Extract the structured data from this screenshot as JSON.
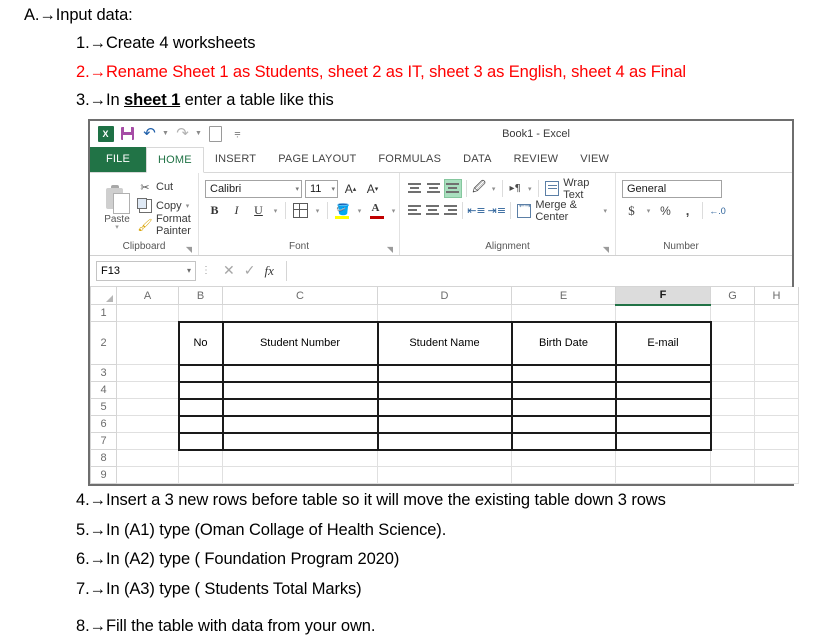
{
  "document": {
    "top_lines": [
      {
        "indent": "a",
        "prefix": "A.",
        "arrow": "→",
        "text": "Input data:",
        "color": "black",
        "bold_part": ""
      },
      {
        "indent": "n",
        "prefix": "1.",
        "arrow": "→",
        "text": "Create 4 worksheets",
        "color": "black"
      },
      {
        "indent": "n",
        "prefix": "2.",
        "arrow": "→",
        "text": "Rename Sheet 1 as Students, sheet 2 as IT, sheet 3 as English, sheet 4 as Final",
        "color": "red"
      },
      {
        "indent": "n",
        "prefix": "3.",
        "arrow": "→",
        "text_before": "In ",
        "text_bold": "sheet 1",
        "text_after": " enter a table like this",
        "color": "black"
      }
    ],
    "bottom_lines": [
      {
        "prefix": "4.",
        "arrow": "→",
        "text": "Insert a 3 new rows before table so it will move the existing table down 3 rows"
      },
      {
        "prefix": "5.",
        "arrow": "→",
        "text": "In (A1) type (Oman Collage of Health Science)."
      },
      {
        "prefix": "6.",
        "arrow": "→",
        "text": "In (A2) type ( Foundation Program 2020)"
      },
      {
        "prefix": "7.",
        "arrow": "→",
        "text": "In (A3) type ( Students Total Marks)"
      },
      {
        "prefix": "8.",
        "arrow": "→",
        "text": "Fill the table with data from your own."
      }
    ],
    "colors": {
      "red": "#ff0000",
      "black": "#000000"
    }
  },
  "excel": {
    "title": "Book1 - Excel",
    "quick_access": [
      {
        "name": "excel-logo",
        "glyph": "X"
      },
      {
        "name": "save-icon",
        "glyph": ""
      },
      {
        "name": "undo-icon",
        "glyph": "↶"
      },
      {
        "name": "redo-icon",
        "glyph": "↷"
      },
      {
        "name": "new-icon",
        "glyph": ""
      },
      {
        "name": "customize-qat-icon",
        "glyph": "≡"
      }
    ],
    "tabs": [
      {
        "label": "FILE",
        "state": "file"
      },
      {
        "label": "HOME",
        "state": "active"
      },
      {
        "label": "INSERT",
        "state": "normal"
      },
      {
        "label": "PAGE LAYOUT",
        "state": "normal"
      },
      {
        "label": "FORMULAS",
        "state": "normal"
      },
      {
        "label": "DATA",
        "state": "normal"
      },
      {
        "label": "REVIEW",
        "state": "normal"
      },
      {
        "label": "VIEW",
        "state": "normal"
      }
    ],
    "ribbon": {
      "clipboard": {
        "group_label": "Clipboard",
        "paste_label": "Paste",
        "items": [
          {
            "label": "Cut",
            "icon": "scissors-icon"
          },
          {
            "label": "Copy",
            "icon": "copy-icon"
          },
          {
            "label": "Format Painter",
            "icon": "format-painter-icon"
          }
        ]
      },
      "font": {
        "group_label": "Font",
        "font_name": "Calibri",
        "font_size": "11",
        "grow_label": "A",
        "shrink_label": "A",
        "bold_label": "B",
        "italic_label": "I",
        "underline_label": "U"
      },
      "alignment": {
        "group_label": "Alignment",
        "wrap_text_label": "Wrap Text",
        "merge_center_label": "Merge & Center"
      },
      "number": {
        "group_label": "Number",
        "format_value": "General",
        "currency_label": "$",
        "percent_label": "%",
        "comma_label": ","
      }
    },
    "formula_bar": {
      "name_box_value": "F13",
      "cancel_icon": "✕",
      "enter_icon": "✓",
      "function_icon": "fx",
      "formula_value": ""
    },
    "grid": {
      "columns": [
        "A",
        "B",
        "C",
        "D",
        "E",
        "F",
        "G",
        "H"
      ],
      "selected_column": "F",
      "rows": [
        "1",
        "2",
        "3",
        "4",
        "5",
        "6",
        "7",
        "8",
        "9"
      ],
      "table_headers": [
        "No",
        "Student Number",
        "Student Name",
        "Birth Date",
        "E-mail"
      ],
      "table_header_row": "2",
      "table_body_rows": [
        "3",
        "4",
        "5",
        "6",
        "7"
      ],
      "table_columns": [
        "B",
        "C",
        "D",
        "E",
        "F"
      ]
    }
  }
}
